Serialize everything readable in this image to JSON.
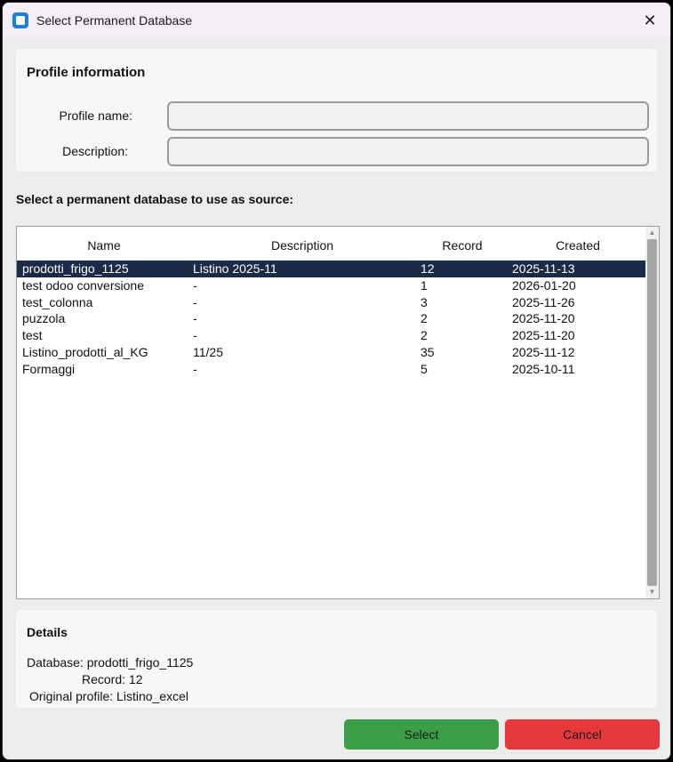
{
  "window": {
    "title": "Select Permanent Database",
    "close_glyph": "✕"
  },
  "profile": {
    "heading": "Profile information",
    "name_label": "Profile name:",
    "name_value": "",
    "description_label": "Description:",
    "description_value": ""
  },
  "list": {
    "label": "Select a permanent database to use as source:",
    "columns": {
      "name": "Name",
      "description": "Description",
      "record": "Record",
      "created": "Created"
    },
    "rows": [
      {
        "name": "prodotti_frigo_1125",
        "description": "Listino 2025-11",
        "record": "12",
        "created": "2025-11-13"
      },
      {
        "name": "test odoo conversione",
        "description": "-",
        "record": "1",
        "created": "2026-01-20"
      },
      {
        "name": "test_colonna",
        "description": "-",
        "record": "3",
        "created": "2025-11-26"
      },
      {
        "name": "puzzola",
        "description": "-",
        "record": "2",
        "created": "2025-11-20"
      },
      {
        "name": "test",
        "description": "-",
        "record": "2",
        "created": "2025-11-20"
      },
      {
        "name": "Listino_prodotti_al_KG",
        "description": "11/25",
        "record": "35",
        "created": "2025-11-12"
      },
      {
        "name": "Formaggi",
        "description": "-",
        "record": "5",
        "created": "2025-10-11"
      }
    ],
    "selected_index": 0
  },
  "details": {
    "heading": "Details",
    "database_line": "Database: prodotti_frigo_1125",
    "record_line": "Record: 12",
    "original_profile_line": "Original profile: Listino_excel"
  },
  "buttons": {
    "select_label": "Select",
    "cancel_label": "Cancel"
  },
  "colors": {
    "selection": "#1b2a47",
    "select_button": "#3c9e47",
    "cancel_button": "#e5393b",
    "app_icon": "#1e7fd8"
  },
  "icons": {
    "app": "app-icon",
    "close": "close-icon",
    "scroll_up": "scroll-up-arrow-icon",
    "scroll_down": "scroll-down-arrow-icon"
  }
}
